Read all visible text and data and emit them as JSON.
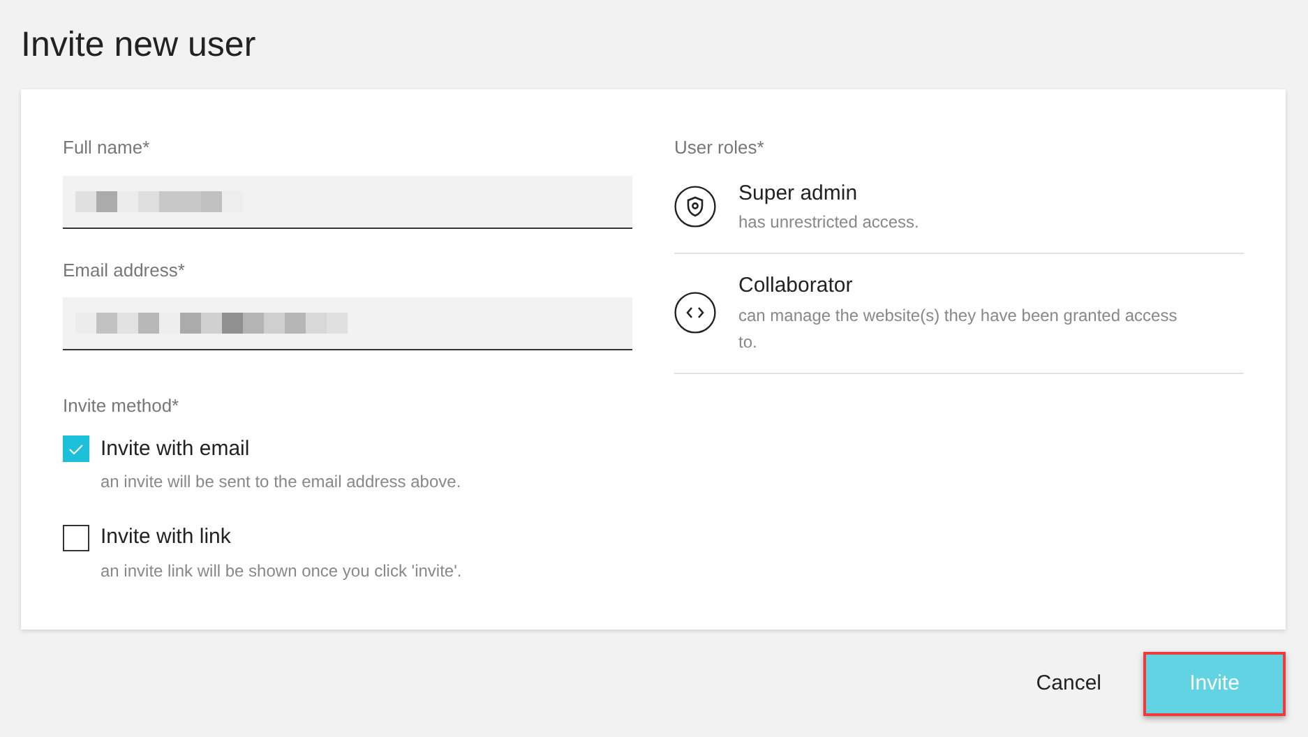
{
  "title": "Invite new user",
  "fields": [
    {
      "label": "Full name*"
    },
    {
      "label": "Email address*"
    }
  ],
  "invite_method": {
    "label": "Invite method*",
    "options": [
      {
        "label": "Invite with email",
        "hint": "an invite will be sent to the email address above.",
        "checked": true
      },
      {
        "label": "Invite with link",
        "hint": "an invite link will be shown once you click 'invite'.",
        "checked": false
      }
    ]
  },
  "user_roles": {
    "label": "User roles*",
    "roles": [
      {
        "kind": "shield",
        "name": "Super admin",
        "description": "has unrestricted access."
      },
      {
        "kind": "code",
        "name": "Collaborator",
        "description": "can manage the website(s) they have been granted access to."
      }
    ]
  },
  "buttons": [
    {
      "kind": "text",
      "label": "Cancel",
      "highlighted": false
    },
    {
      "kind": "primary",
      "label": "Invite",
      "highlighted": true
    }
  ]
}
